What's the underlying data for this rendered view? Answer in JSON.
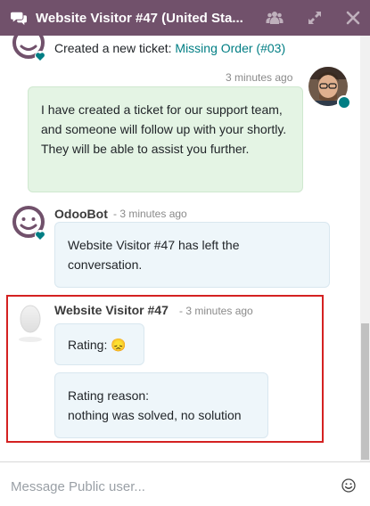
{
  "header": {
    "title": "Website Visitor #47 (United Sta..."
  },
  "thread": {
    "log_message": {
      "prefix": "Created a new ticket:",
      "link": "Missing Order (#03)"
    },
    "agent_message": {
      "timestamp": "3 minutes ago",
      "text": "I have created a ticket for our support team, and someone will follow up with your shortly. They will be able to assist you further."
    },
    "bot_message": {
      "author": "OdooBot",
      "timestamp": "- 3 minutes ago",
      "text": "Website Visitor #47 has left the conversation."
    },
    "visitor_message": {
      "author": "Website Visitor #47",
      "timestamp": "- 3 minutes ago",
      "rating_label": "Rating:",
      "rating_emoji": "😞",
      "reason_label": "Rating reason:",
      "reason_text": "nothing was solved, no solution"
    }
  },
  "composer": {
    "placeholder": "Message Public user..."
  },
  "colors": {
    "header_bg": "#71516b",
    "link": "#017e84",
    "online_dot": "#017e84",
    "highlight": "#d42121"
  },
  "icons": [
    "comments-icon",
    "users-icon",
    "expand-icon",
    "close-icon",
    "odoobot-avatar",
    "agent-avatar",
    "visitor-avatar",
    "emoji-icon"
  ]
}
